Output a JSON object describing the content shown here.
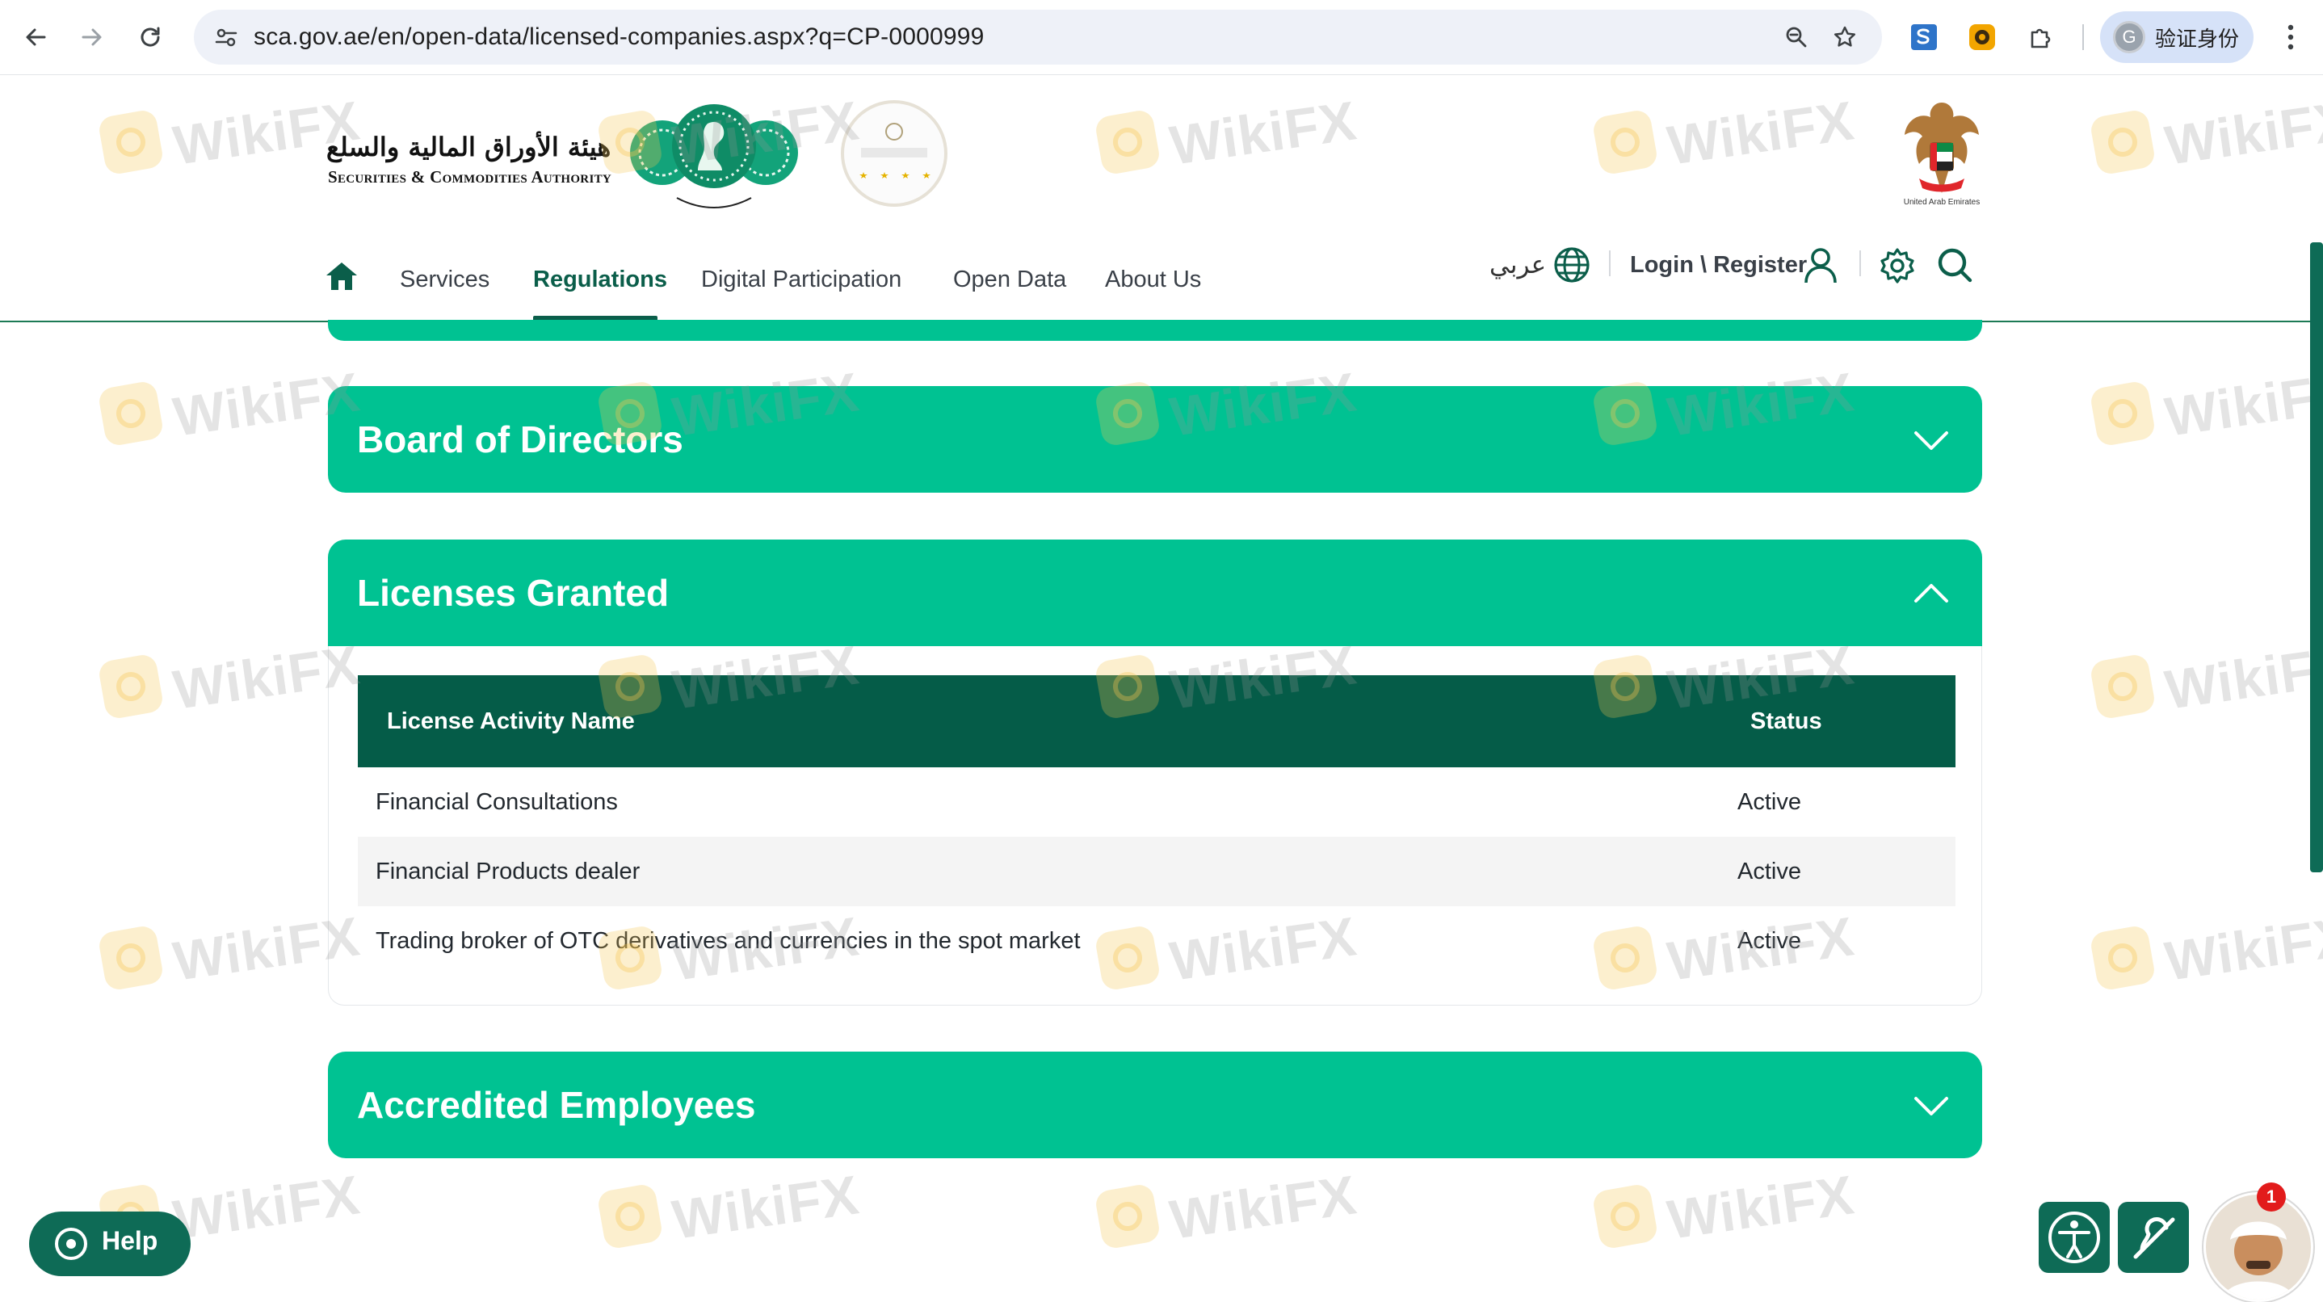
{
  "browser": {
    "url": "sca.gov.ae/en/open-data/licensed-companies.aspx?q=CP-0000999",
    "profile_label": "验证身份",
    "profile_initial": "G"
  },
  "header": {
    "logo_ar": "هيئة الأوراق المالية والسلع",
    "logo_en": "Securities & Commodities Authority",
    "uae_caption": "United Arab Emirates",
    "nav": [
      {
        "label": "Services"
      },
      {
        "label": "Regulations"
      },
      {
        "label": "Digital Participation"
      },
      {
        "label": "Open Data"
      },
      {
        "label": "About Us"
      }
    ],
    "language": "عربي",
    "login": "Login \\ Register"
  },
  "panels": {
    "board": {
      "title": "Board of Directors"
    },
    "licenses": {
      "title": "Licenses Granted",
      "columns": [
        "License Activity Name",
        "Status"
      ],
      "rows": [
        {
          "name": "Financial Consultations",
          "status": "Active"
        },
        {
          "name": "Financial Products dealer",
          "status": "Active"
        },
        {
          "name": "Trading broker of OTC derivatives and currencies in the spot market",
          "status": "Active"
        }
      ]
    },
    "employees": {
      "title": "Accredited Employees"
    }
  },
  "watermark": "WikiFX",
  "widgets": {
    "help": "Help",
    "chat_badge": "1"
  },
  "colors": {
    "accent": "#00c292",
    "table_header": "#055c48",
    "nav_active": "#0b5e4a"
  }
}
